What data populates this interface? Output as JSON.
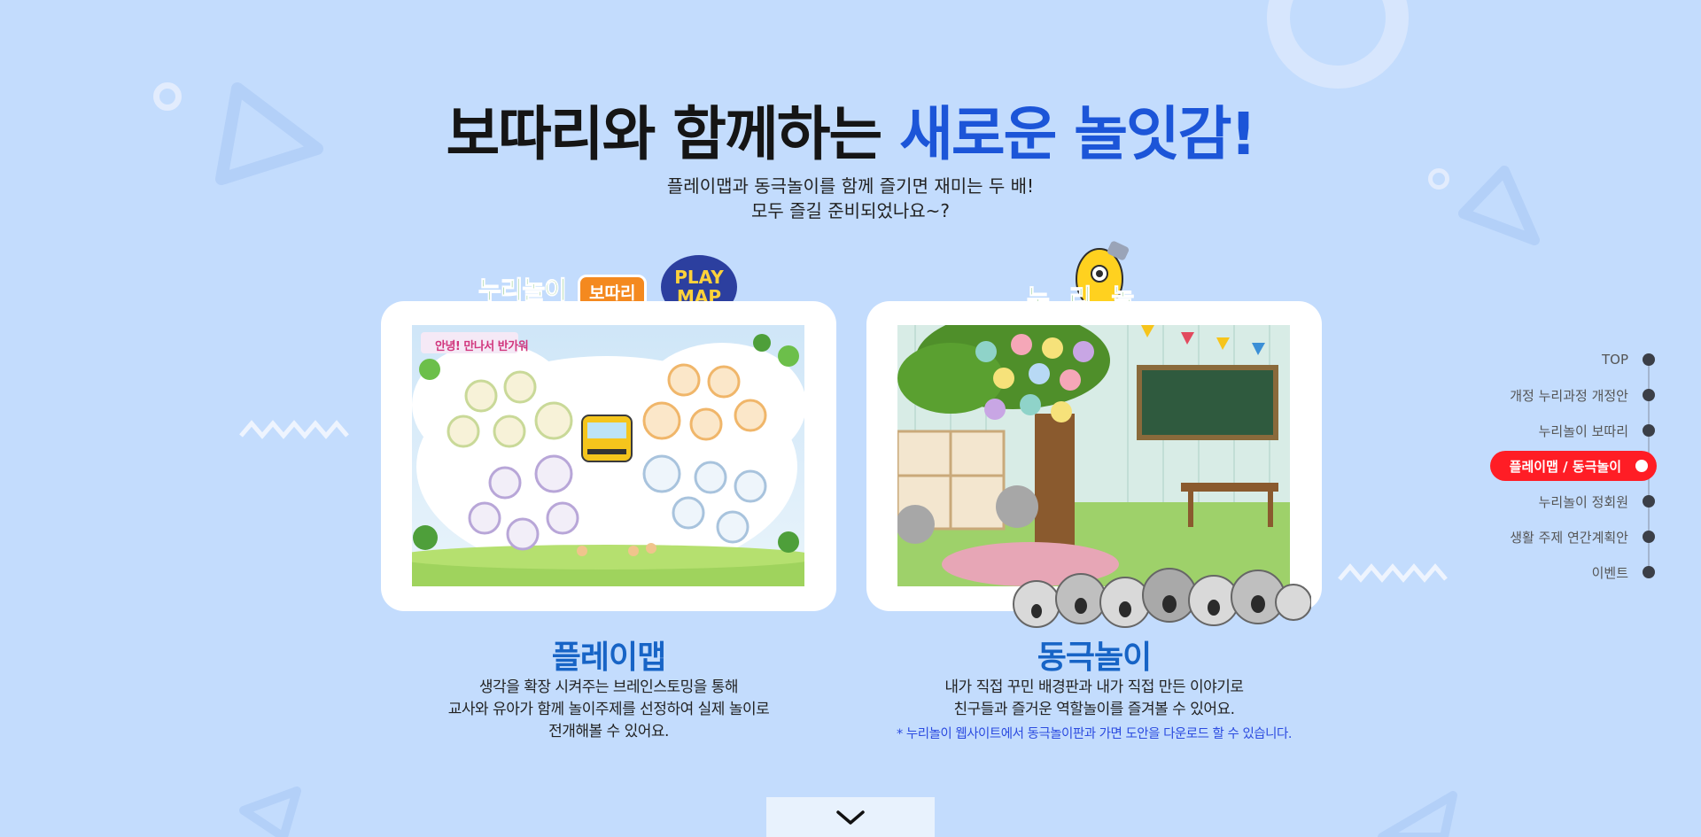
{
  "headline": {
    "main": "보따리와 함께하는 ",
    "accent": "새로운 놀잇감!"
  },
  "subtitle": {
    "line1": "플레이맵과 동극놀이를 함께 즐기면 재미는 두 배!",
    "line2": "모두 즐길 준비되었나요~?"
  },
  "left_card": {
    "logo_text_1": "누리놀이",
    "logo_text_2": "보따리",
    "badge_text_1": "PLAY",
    "badge_text_2": "MAP",
    "screen_banner": "안녕! 만나서 반가워",
    "title": "플레이맵",
    "desc_1": "생각을 확장 시켜주는 브레인스토밍을 통해",
    "desc_2": "교사와 유아가 함께 놀이주제를 선정하여 실제 놀이로",
    "desc_3": "전개해볼 수 있어요."
  },
  "right_card": {
    "logo_text": "누리놀이",
    "title": "동극놀이",
    "desc_1": "내가 직접 꾸민 배경판과 내가 직접 만든 이야기로",
    "desc_2": "친구들과 즐거운 역할놀이를 즐겨볼 수 있어요.",
    "note": "* 누리놀이 웹사이트에서 동극놀이판과 가면 도안을 다운로드 할 수 있습니다."
  },
  "sidenav": {
    "items": [
      {
        "label": "TOP"
      },
      {
        "label": "개정 누리과정 개정안"
      },
      {
        "label": "누리놀이 보따리"
      },
      {
        "label": "플레이맵 / 동극놀이"
      },
      {
        "label": "누리놀이 정회원"
      },
      {
        "label": "생활 주제 연간계획안"
      },
      {
        "label": "이벤트"
      }
    ],
    "active_index": 3
  },
  "colors": {
    "background": "#c3dcfd",
    "accent_blue": "#1c55d8",
    "title_blue": "#1764c6",
    "nav_active": "#ff1d25"
  },
  "icons": {
    "scroll": "chevron-down-icon"
  }
}
